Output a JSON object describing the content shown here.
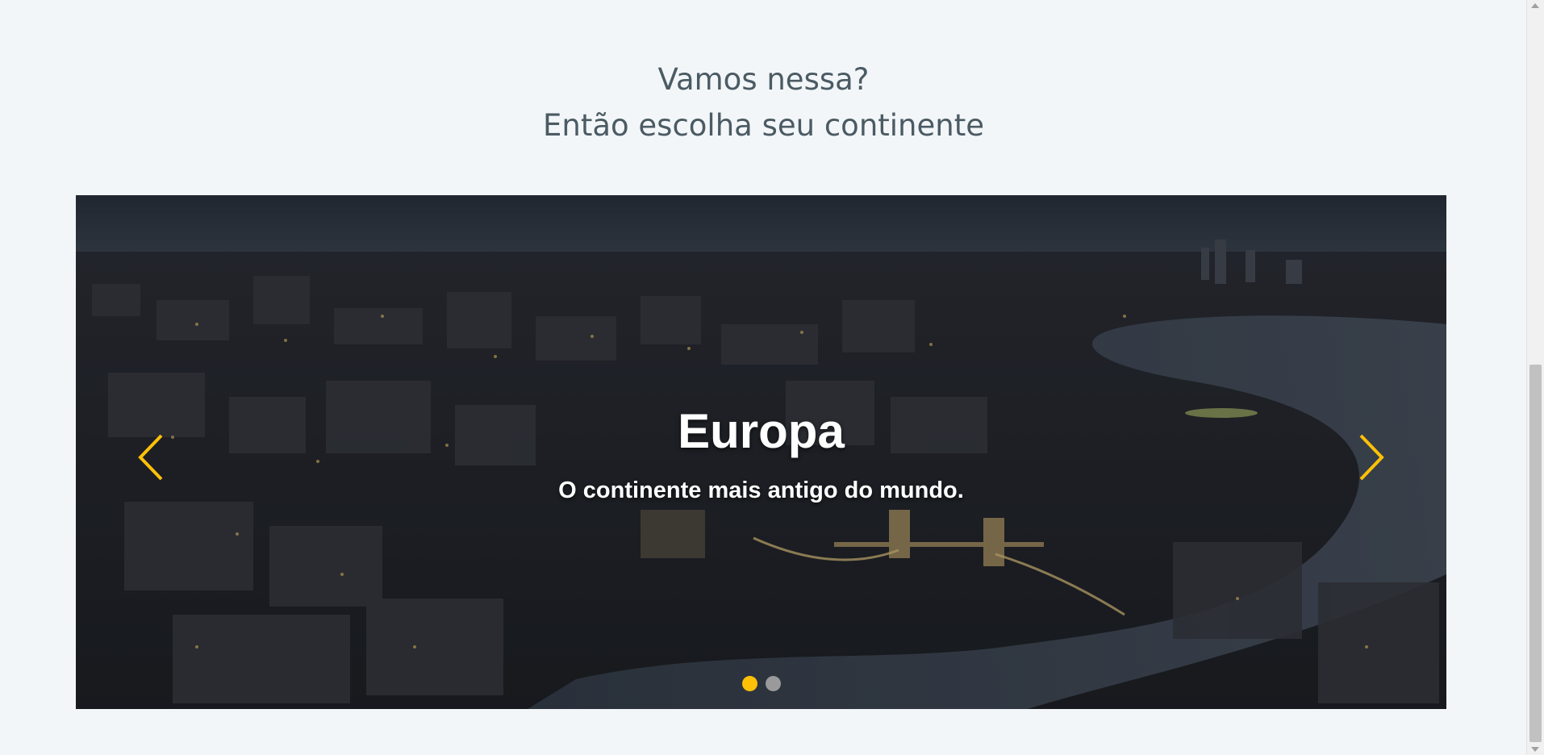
{
  "section": {
    "heading_line1": "Vamos nessa?",
    "heading_line2": "Então escolha seu continente"
  },
  "carousel": {
    "active_index": 0,
    "slides": [
      {
        "title": "Europa",
        "subtitle": "O continente mais antigo do mundo.",
        "image": "night aerial city skyline with river and tower bridge"
      }
    ],
    "slide_count": 2,
    "prev_icon": "chevron-left-icon",
    "next_icon": "chevron-right-icon",
    "colors": {
      "accent": "#ffc107",
      "indicator_inactive": "#9a9a9a",
      "caption_text": "#ffffff"
    }
  },
  "colors": {
    "page_background": "#f3f6f9",
    "heading_text": "#4b5b63"
  }
}
